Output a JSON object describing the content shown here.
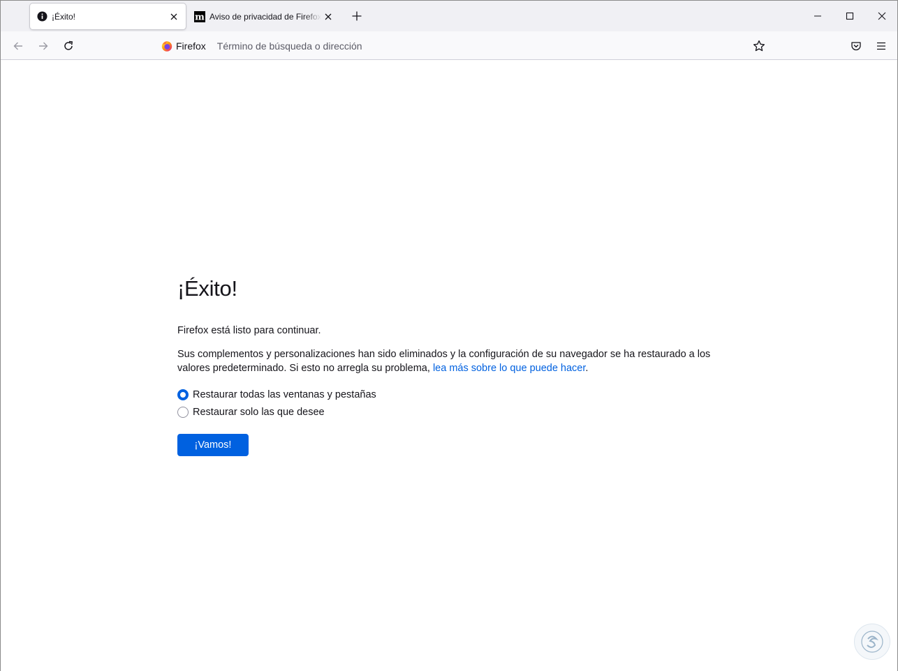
{
  "tabs": [
    {
      "title": "¡Éxito!",
      "active": true,
      "icon": "info-icon"
    },
    {
      "title": "Aviso de privacidad de Firefox — Mozilla",
      "active": false,
      "icon": "mozilla-m-icon"
    }
  ],
  "navbar": {
    "identity_label": "Firefox",
    "url_placeholder": "Término de búsqueda o dirección"
  },
  "page": {
    "title": "¡Éxito!",
    "ready_text": "Firefox está listo para continuar.",
    "description": "Sus complementos y personalizaciones han sido eliminados y la configuración de su navegador se ha restaurado a los valores predeterminado. Si esto no arregla su problema,",
    "learn_more_link": "lea más sobre lo que puede hacer",
    "link_suffix": ".",
    "options": [
      {
        "label": "Restaurar todas las ventanas y pestañas",
        "checked": true
      },
      {
        "label": "Restaurar solo las que desee",
        "checked": false
      }
    ],
    "go_button": "¡Vamos!"
  },
  "colors": {
    "accent": "#0061e0",
    "tabstrip": "#f0f0f4",
    "toolbar": "#f9f9fb"
  }
}
